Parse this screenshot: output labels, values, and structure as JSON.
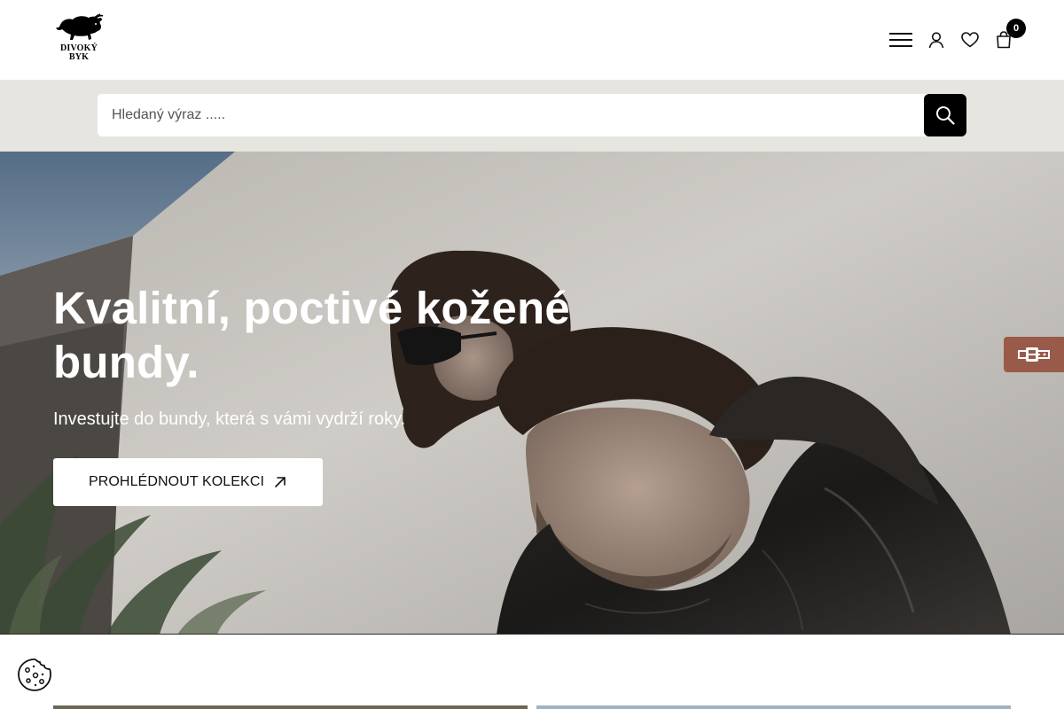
{
  "header": {
    "logo": {
      "line1": "DIVOKÝ",
      "line2": "BYK",
      "icon": "bull-logo-icon"
    },
    "icons": {
      "menu": "hamburger-menu-icon",
      "account": "user-icon",
      "wishlist": "heart-icon",
      "cart": "shopping-bag-icon"
    },
    "cart_count": "0"
  },
  "search": {
    "placeholder": "Hledaný výraz .....",
    "value": "",
    "button_icon": "search-icon"
  },
  "hero": {
    "title": "Kvalitní, poctivé kožené bundy.",
    "subtitle": "Investujte do bundy, která s vámi vydrží roky.",
    "cta_label": "PROHLÉDNOUT KOLEKCI",
    "cta_icon": "arrow-up-right-icon"
  },
  "side_tab": {
    "icon": "belt-icon",
    "color": "#9a5a4a"
  },
  "cookie": {
    "icon": "cookie-icon"
  },
  "colors": {
    "search_band": "#e6e5df",
    "button_dark": "#000000",
    "text_light": "#ffffff"
  }
}
